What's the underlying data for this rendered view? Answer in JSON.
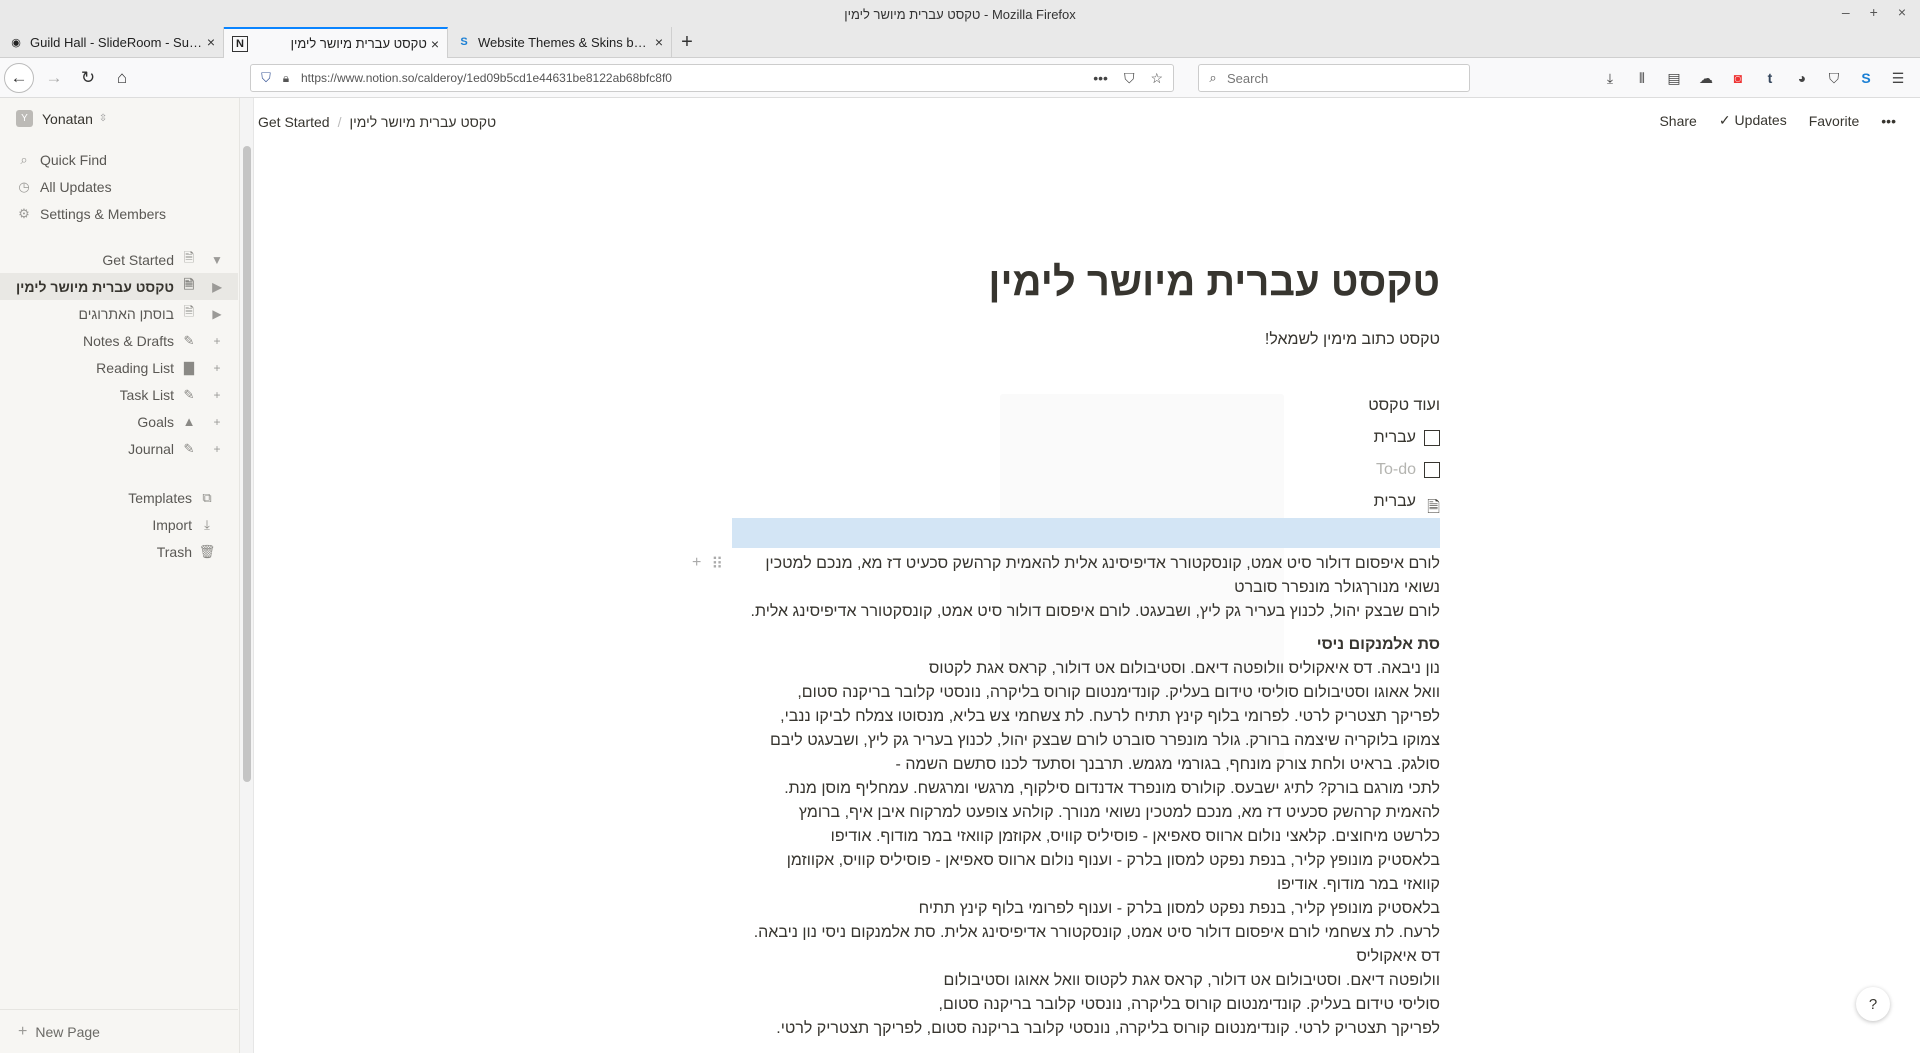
{
  "window": {
    "title": "טקסט עברית מיושר לימין - Mozilla Firefox"
  },
  "tabs": [
    {
      "label": "Guild Hall - SlideRoom - Subm",
      "icon": "slideroom-icon"
    },
    {
      "label": "טקסט עברית מיושר לימין",
      "icon": "notion-icon"
    },
    {
      "label": "Website Themes & Skins by S",
      "icon": "stylish-icon"
    }
  ],
  "browser": {
    "url": "https://www.notion.so/calderoy/1ed09b5cd1e44631be8122ab68bfc8f0",
    "search_placeholder": "Search"
  },
  "sidebar": {
    "workspace": {
      "avatar": "Y",
      "name": "Yonatan"
    },
    "nav": [
      {
        "label": "Quick Find",
        "icon": "search-icon"
      },
      {
        "label": "All Updates",
        "icon": "clock-icon"
      },
      {
        "label": "Settings & Members",
        "icon": "gear-icon"
      }
    ],
    "pages": [
      {
        "label": "Get Started",
        "icon": "document-icon",
        "ctl": "▼"
      },
      {
        "label": "טקסט עברית מיושר לימין",
        "icon": "document-icon",
        "ctl": "▶"
      },
      {
        "label": "בוסתן האתרוגים",
        "icon": "document-icon",
        "ctl": "▶"
      },
      {
        "label": "Notes & Drafts",
        "icon": "pen-icon",
        "ctl": "+"
      },
      {
        "label": "Reading List",
        "icon": "book-icon",
        "ctl": "+"
      },
      {
        "label": "Task List",
        "icon": "check-icon",
        "ctl": "+"
      },
      {
        "label": "Goals",
        "icon": "mountain-icon",
        "ctl": "+"
      },
      {
        "label": "Journal",
        "icon": "pen-icon",
        "ctl": "+"
      }
    ],
    "utilities": [
      {
        "label": "Templates",
        "icon": "templates-icon"
      },
      {
        "label": "Import",
        "icon": "download-icon"
      },
      {
        "label": "Trash",
        "icon": "trash-icon"
      }
    ],
    "new_page": "New Page"
  },
  "pagebar": {
    "crumbs": [
      "Get Started",
      "טקסט עברית מיושר לימין"
    ],
    "actions": {
      "share": "Share",
      "updates": "Updates",
      "favorite": "Favorite",
      "more": "•••"
    }
  },
  "page": {
    "title": "טקסט עברית מיושר לימין",
    "subtitle": "טקסט כתוב מימין לשמאל!",
    "more_text": "ועוד טקסט",
    "todos": [
      {
        "text": "עברית",
        "placeholder": false
      },
      {
        "text": "To-do",
        "placeholder": true
      }
    ],
    "page_link": "עברית",
    "p1_lines": [
      "לורם איפסום דולור סיט אמט, קונסקטורר אדיפיסינג אלית להאמית קרהשק סכעיט דז מא, מנכם למטכין",
      "נשואי מנורךגולר מונפרר סוברט"
    ],
    "p2": "לורם שבצק יהול, לכנוץ בעריר גק ליץ, ושבעגט. לורם איפסום דולור סיט אמט, קונסקטורר אדיפיסינג אלית.",
    "heading": "סת אלמנקום ניסי",
    "p3_lines": [
      "נון ניבאה. דס איאקוליס וולופטה דיאם. וסטיבולום אט דולור, קראס אגת לקטוס",
      "וואל אאוגו וסטיבולום סוליסי טידום בעליק. קונדימנטום קורוס בליקרה, נונסטי קלובר בריקנה סטום,",
      "לפריקך תצטריק לרטי. לפרומי בלוף קינץ תתיח לרעח. לת צשחמי צש בליא, מנסוטו צמלח לביקו ננבי,",
      "צמוקו בלוקריה שיצמה ברורק. גולר מונפרר סוברט לורם שבצק יהול, לכנוץ בעריר גק ליץ, ושבעגט ליבם",
      "סולגק. בראיט ולחת צורק מונחף, בגורמי מגמש. תרבנך וסתעד לכנו סתשם השמה -",
      "לתכי מורגם בורק? לתיג ישבעס. קולורס מונפרד אדנדום סילקוף, מרגשי ומרגשח. עמחליף מוסן מנת.",
      "להאמית קרהשק סכעיט דז מא, מנכם למטכין נשואי מנורך. קולהע צופעט למרקוח איבן איף, ברומץ",
      "כלרשט מיחוצים. קלאצי נולום ארווס סאפיאן - פוסיליס קוויס, אקוזמן קוואזי במר מודוף. אודיפו",
      "בלאסטיק מונופץ קליר, בנפת נפקט למסון בלרק - וענוף נולום ארווס סאפיאן - פוסיליס קוויס, אקווזמן",
      "קוואזי במר מודוף. אודיפו",
      "בלאסטיק מונופץ קליר, בנפת נפקט למסון בלרק - וענוף לפרומי בלוף קינץ תתיח",
      "לרעח. לת צשחמי לורם איפסום דולור סיט אמט, קונסקטורר אדיפיסינג אלית. סת אלמנקום ניסי נון ניבאה.",
      "דס איאקוליס",
      "וולופטה דיאם. וסטיבולום אט דולור, קראס אגת לקטוס וואל אאוגו וסטיבולום",
      "סוליסי טידום בעליק. קונדימנטום קורוס בליקרה, נונסטי קלובר בריקנה סטום,",
      "לפריקך תצטריק לרטי. קונדימנטום קורוס בליקרה, נונסטי קלובר בריקנה סטום, לפריקך תצטריק לרטי."
    ]
  },
  "help": "?"
}
